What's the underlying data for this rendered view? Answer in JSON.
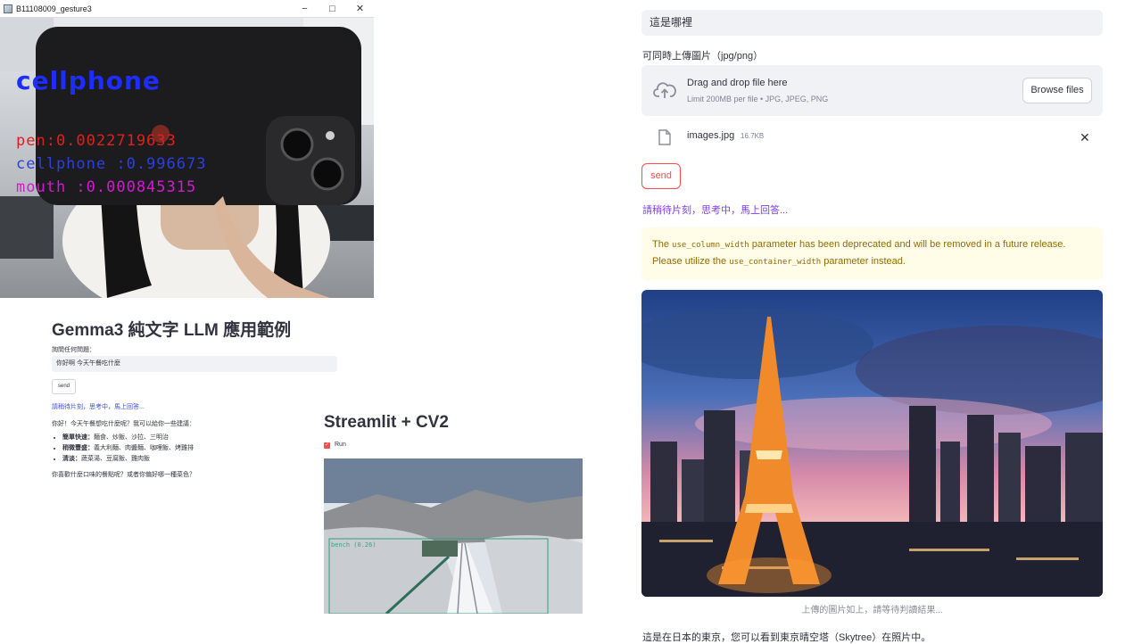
{
  "cv_window": {
    "title": "B11108009_gesture3",
    "minimize": "−",
    "maximize": "□",
    "close": "✕",
    "detection_main": "cellphone",
    "detections": [
      {
        "label": "pen:0.0022719633",
        "color": "#e0201a"
      },
      {
        "label": "cellphone :0.996673",
        "color": "#2c3fe0"
      },
      {
        "label": "mouth :0.000845315",
        "color": "#d21ad2"
      }
    ]
  },
  "gemma": {
    "title": "Gemma3 純文字 LLM 應用範例",
    "prompt_label": "詢問任何問題：",
    "input_value": "你好啊 今天午餐吃什麼",
    "send": "send",
    "wait": "請稍待片刻，思考中，馬上回答...",
    "answer_intro": "你好！今天午餐想吃什麼呢？我可以給你一些建議：",
    "answer_items": [
      {
        "bold": "簡單快速：",
        "text": "麵食、炒飯、沙拉、三明治"
      },
      {
        "bold": "稍微豐盛：",
        "text": "義大利麵、肉醬麵、咖哩飯、烤雞排"
      },
      {
        "bold": "清淡：",
        "text": "蔬菜湯、豆腐飯、雞肉飯"
      }
    ],
    "answer_outro": "你喜歡什麼口味的餐點呢？或者你偏好哪一種菜色？"
  },
  "cv2": {
    "title": "Streamlit + CV2",
    "run_label": "Run",
    "bench_label": "bench (0.26)"
  },
  "right": {
    "question_value": "這是哪裡",
    "upload_label": "可同時上傳圖片（jpg/png）",
    "drop_main": "Drag and drop file here",
    "drop_sub": "Limit 200MB per file • JPG, JPEG, PNG",
    "browse": "Browse files",
    "file_name": "images.jpg",
    "file_size": "16.7KB",
    "file_remove": "✕",
    "send": "send",
    "wait": "請稍待片刻，思考中，馬上回答...",
    "warning": {
      "part1": "The",
      "code1": "use_column_width",
      "part2": "parameter has been deprecated and will be removed in a future release. Please utilize the",
      "code2": "use_container_width",
      "part3": "parameter instead."
    },
    "caption": "上傳的圖片如上，請等待判讀結果...",
    "result": "這是在日本的東京，您可以看到東京晴空塔（Skytree）在照片中。"
  }
}
